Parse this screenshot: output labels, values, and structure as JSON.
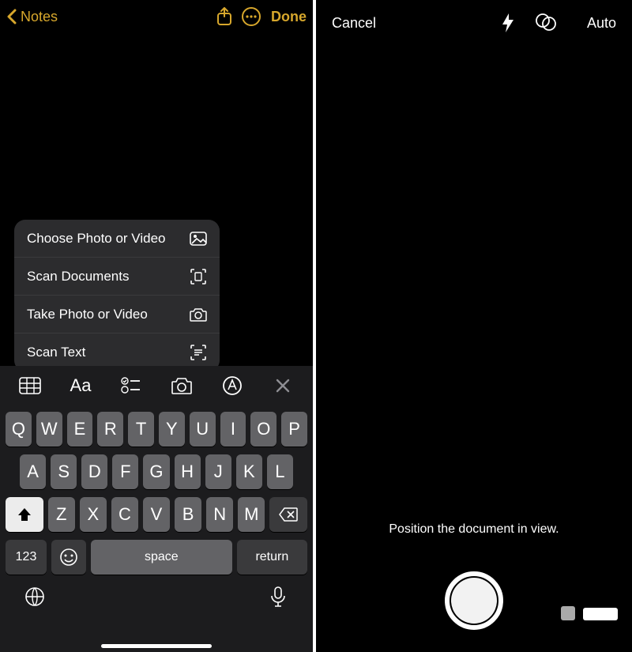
{
  "colors": {
    "accent": "#d7a72c"
  },
  "notes": {
    "back_label": "Notes",
    "done_label": "Done",
    "menu": [
      {
        "label": "Choose Photo or Video",
        "icon": "photo"
      },
      {
        "label": "Scan Documents",
        "icon": "scan"
      },
      {
        "label": "Take Photo or Video",
        "icon": "camera"
      },
      {
        "label": "Scan Text",
        "icon": "text-scan"
      }
    ],
    "format_bar": [
      "table",
      "Aa",
      "checklist",
      "camera",
      "markup",
      "close"
    ],
    "keyboard": {
      "row1": [
        "Q",
        "W",
        "E",
        "R",
        "T",
        "Y",
        "U",
        "I",
        "O",
        "P"
      ],
      "row2": [
        "A",
        "S",
        "D",
        "F",
        "G",
        "H",
        "J",
        "K",
        "L"
      ],
      "row3": [
        "Z",
        "X",
        "C",
        "V",
        "B",
        "N",
        "M"
      ],
      "num_label": "123",
      "space_label": "space",
      "return_label": "return"
    }
  },
  "scan": {
    "cancel_label": "Cancel",
    "auto_label": "Auto",
    "hint": "Position the document in view."
  }
}
